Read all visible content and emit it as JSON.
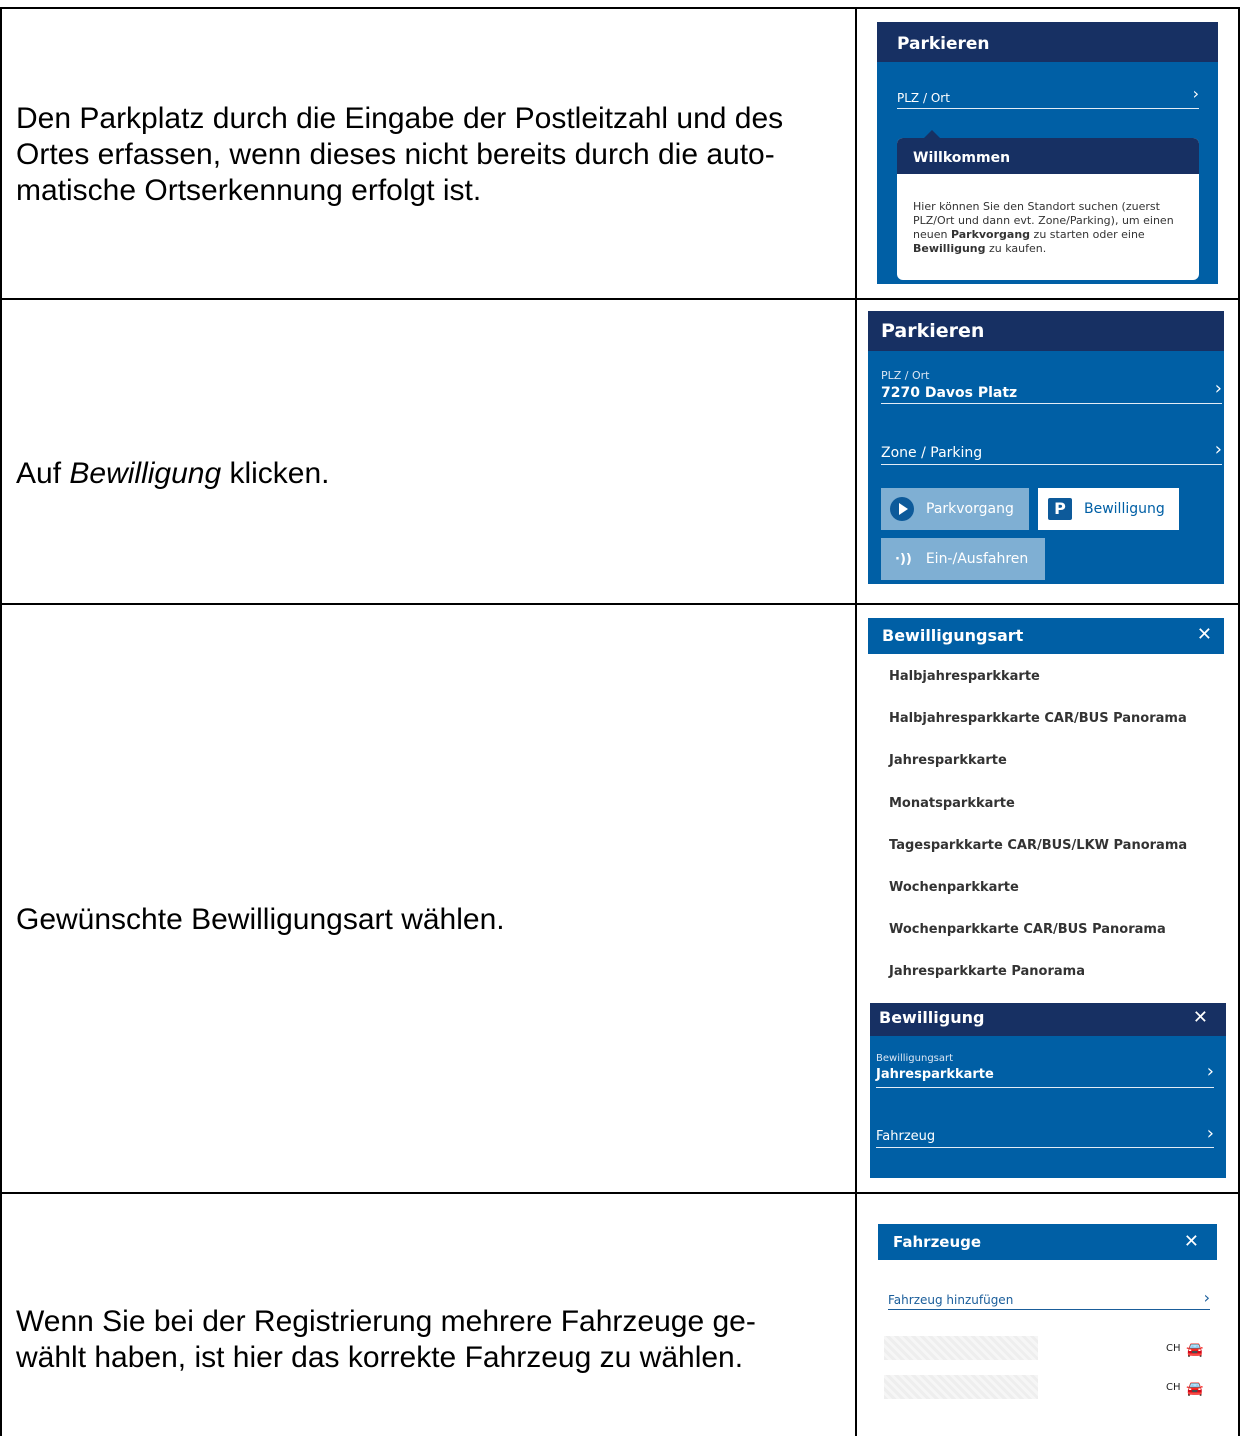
{
  "rows": [
    {
      "instruction": "Den Parkplatz durch die Eingabe der Postleitzahl und des Ortes erfassen, wenn dieses nicht bereits durch die automatische Ortserkennung erfolgt ist.",
      "instruction_lines": [
        "Den Parkplatz durch die Eingabe der Postleitzahl und des",
        "Ortes erfassen, wenn dieses nicht bereits durch die auto-",
        "matische Ortserkennung erfolgt ist."
      ],
      "panel": {
        "title": "Parkieren",
        "field_label": "PLZ / Ort",
        "tooltip_title": "Willkommen",
        "tooltip_text_1": "Hier können Sie den Standort suchen (zuerst",
        "tooltip_text_2": "PLZ/Ort und dann evt. Zone/Parking), um einen",
        "tooltip_text_3_prefix": "neuen ",
        "tooltip_text_3_bold": "Parkvorgang",
        "tooltip_text_3_suffix": " zu starten oder eine",
        "tooltip_text_4_bold": "Bewilligung",
        "tooltip_text_4_suffix": " zu kaufen."
      }
    },
    {
      "instruction_prefix": "Auf ",
      "instruction_italic": "Bewilligung",
      "instruction_suffix": " klicken.",
      "panel": {
        "title": "Parkieren",
        "plz_label": "PLZ / Ort",
        "plz_value": "7270 Davos Platz",
        "zone_label": "Zone / Parking",
        "btn_parkvorgang": "Parkvorgang",
        "btn_bewilligung": "Bewilligung",
        "btn_ein_aus": "Ein-/Ausfahren"
      }
    },
    {
      "instruction": "Gewünschte Bewilligungsart wählen.",
      "panel_a": {
        "title": "Bewilligungsart",
        "items": [
          "Halbjahresparkkarte",
          "Halbjahresparkkarte CAR/BUS Panorama",
          "Jahresparkkarte",
          "Monatsparkkarte",
          "Tagesparkkarte CAR/BUS/LKW Panorama",
          "Wochenparkkarte",
          "Wochenparkkarte CAR/BUS Panorama",
          "Jahresparkkarte Panorama"
        ]
      },
      "panel_b": {
        "title": "Bewilligung",
        "type_label": "Bewilligungsart",
        "type_value": "Jahresparkkarte",
        "vehicle_label": "Fahrzeug"
      }
    },
    {
      "instruction_lines": [
        "Wenn Sie bei der Registrierung mehrere Fahrzeuge ge-",
        "wählt haben, ist hier das korrekte Fahrzeug zu wählen."
      ],
      "panel": {
        "title": "Fahrzeuge",
        "add_label": "Fahrzeug hinzufügen",
        "vehicles": [
          {
            "country": "CH"
          },
          {
            "country": "CH"
          }
        ]
      }
    }
  ]
}
